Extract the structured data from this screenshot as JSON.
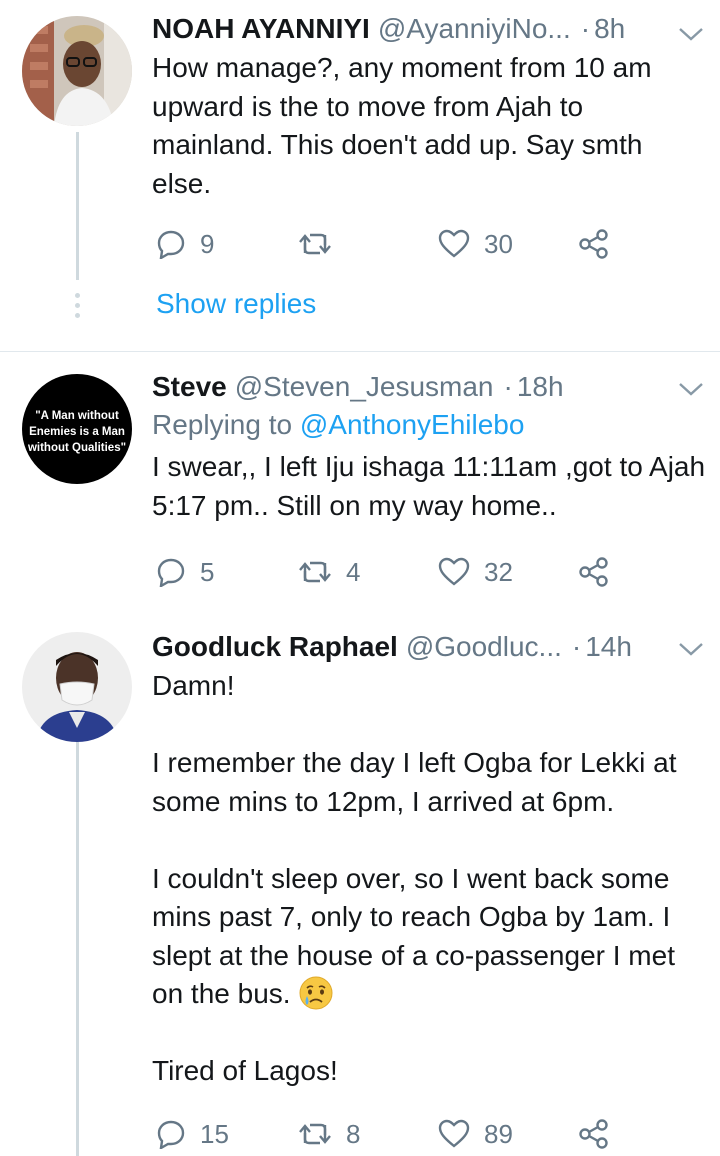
{
  "tweets": [
    {
      "name": "NOAH AYANNIYI",
      "handle": "@AyanniyiNo...",
      "separator": "·",
      "time": "8h",
      "body": "How manage?, any moment from 10 am upward is the to move from Ajah to mainland.  This doen't add up. Say smth else.",
      "replies": "9",
      "retweets": "",
      "likes": "30",
      "show_replies": "Show replies"
    },
    {
      "name": "Steve",
      "handle": "@Steven_Jesusman",
      "separator": "·",
      "time": "18h",
      "replying_label": "Replying to",
      "replying_handle": "@AnthonyEhilebo",
      "avatar_text": "\"A Man without Enemies is a Man without Qualities\"",
      "body": "I swear,, I left Iju ishaga 11:11am ,got to Ajah 5:17 pm.. Still on my way home..",
      "replies": "5",
      "retweets": "4",
      "likes": "32"
    },
    {
      "name": "Goodluck Raphael",
      "handle": "@Goodluc...",
      "separator": "·",
      "time": "14h",
      "body_1": "Damn!\n\nI remember the day I left Ogba for Lekki at some mins to 12pm, I arrived at 6pm.\n\nI couldn't sleep over, so I went back some mins past 7, only to reach Ogba by 1am. I slept at the house of a co-passenger I met on the bus. ",
      "emoji": "crying-face",
      "body_2": "\n\nTired of Lagos!",
      "replies": "15",
      "retweets": "8",
      "likes": "89"
    }
  ],
  "colors": {
    "text": "#14171a",
    "secondary": "#657786",
    "link": "#1da1f2",
    "divider": "#e1e8ed",
    "thread": "#cfd9de"
  }
}
